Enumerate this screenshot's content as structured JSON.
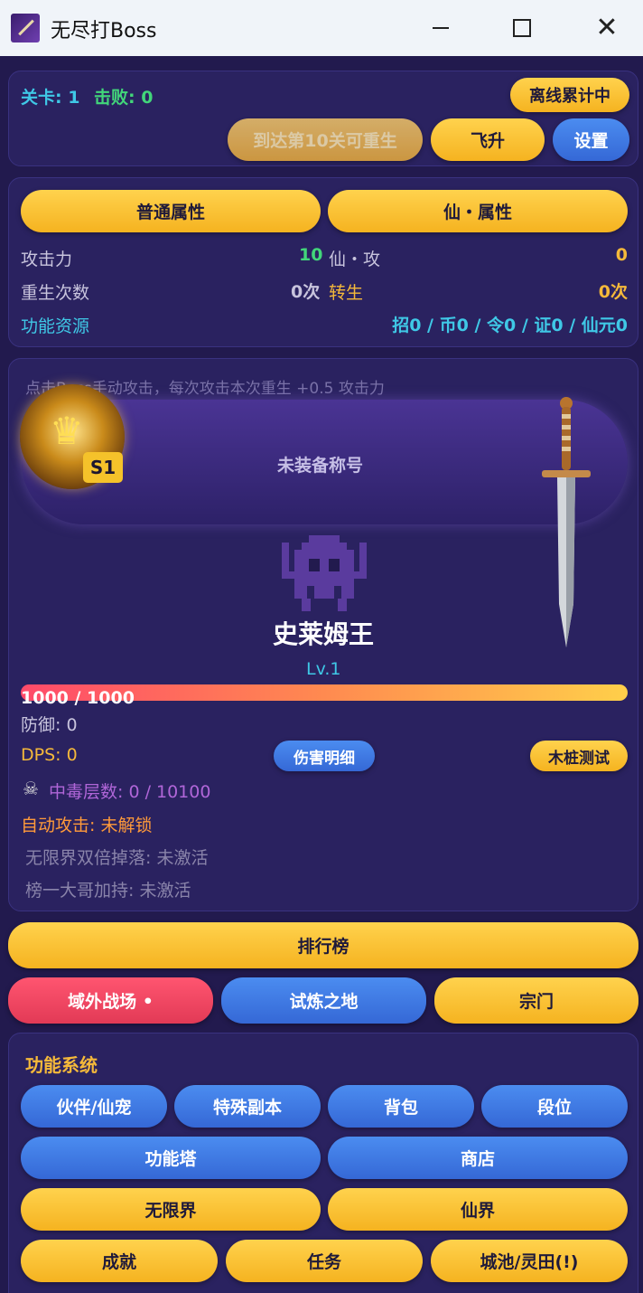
{
  "window": {
    "title": "无尽打Boss"
  },
  "header": {
    "level_label": "关卡: 1",
    "defeated_label": "击败: 0",
    "offline_btn": "离线累计中",
    "rebirth_btn": "到达第10关可重生",
    "ascend_btn": "飞升",
    "settings_btn": "设置"
  },
  "attributes": {
    "tab_normal": "普通属性",
    "tab_immortal": "仙・属性",
    "attack_label": "攻击力",
    "attack_value": "10",
    "immortal_attack_label": "仙・攻",
    "immortal_attack_value": "0",
    "rebirth_count_label": "重生次数",
    "rebirth_count_value": "0次",
    "reincarnation_label": "转生",
    "reincarnation_value": "0次",
    "resources_label": "功能资源",
    "resources_value": "招0 / 币0 / 令0 / 证0 / 仙元0"
  },
  "battle": {
    "hint": "点击Boss手动攻击，每次攻击本次重生 +0.5 攻击力",
    "title_banner": "未装备称号",
    "badge": "S1",
    "boss_name": "史莱姆王",
    "boss_level": "Lv.1",
    "hp_text": "1000 / 1000",
    "hp_fraction": 1.0,
    "defense": "防御: 0",
    "dps": "DPS: 0",
    "damage_detail_btn": "伤害明细",
    "dummy_test_btn": "木桩测试",
    "poison": "中毒层数: 0 / 10100",
    "auto_attack": "自动攻击: 未解锁",
    "infinite_double": "无限界双倍掉落: 未激活",
    "rank_boost": "榜一大哥加持: 未激活"
  },
  "nav": {
    "leaderboard": "排行榜",
    "outer_battlefield": "域外战场 •",
    "trial_land": "试炼之地",
    "sect": "宗门"
  },
  "functions": {
    "title": "功能系统",
    "partner": "伙伴/仙宠",
    "special_dungeon": "特殊副本",
    "backpack": "背包",
    "rank": "段位",
    "function_tower": "功能塔",
    "shop": "商店",
    "infinite_realm": "无限界",
    "immortal_realm": "仙界",
    "achievements": "成就",
    "quests": "任务",
    "city_field": "城池/灵田(!)"
  }
}
